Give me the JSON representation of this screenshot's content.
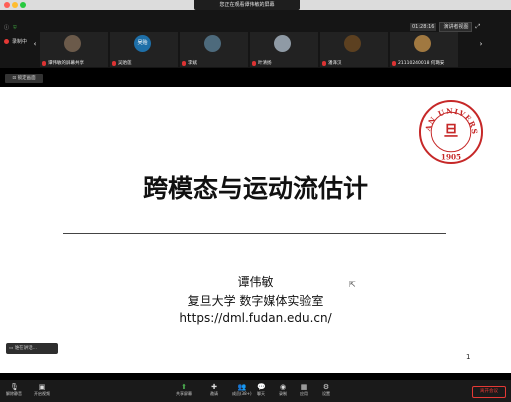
{
  "window": {
    "share_banner": "您正在观看谭伟敏的屏幕"
  },
  "topbar": {
    "recording_label": "录制中",
    "time": "01:28:16",
    "view_label": "演讲者视图",
    "participants": [
      {
        "name": "谭伟敏的屏幕共享",
        "avatar_color": "#6b5a4a"
      },
      {
        "name": "吴贻莲",
        "avatar_color": "#1e6fa8",
        "avatar_text": "吴贻"
      },
      {
        "name": "李斌",
        "avatar_color": "#4d6a7c"
      },
      {
        "name": "叶清扬",
        "avatar_color": "#8f9aa5"
      },
      {
        "name": "潘泽汉",
        "avatar_color": "#5c4020"
      },
      {
        "name": "21110240018 何璐安",
        "avatar_color": "#a07840"
      }
    ]
  },
  "control_label": "锁定画面",
  "slide": {
    "title": "跨模态与运动流估计",
    "author": "谭伟敏",
    "affiliation": "复旦大学 数字媒体实验室",
    "url": "https://dml.fudan.edu.cn/",
    "page_number": "1",
    "seal_text": "FUDAN UNIVERSITY",
    "seal_year": "1905",
    "seal_color": "#c62828"
  },
  "typing_indicator": "谁在讲话...",
  "bottombar": {
    "items": [
      {
        "label": "解除静音",
        "icon": "microphone-icon"
      },
      {
        "label": "开启视频",
        "icon": "video-camera-icon"
      },
      {
        "label": "共享屏幕",
        "icon": "share-screen-icon"
      },
      {
        "label": "邀请",
        "icon": "invite-icon"
      },
      {
        "label": "成员(38+)",
        "icon": "members-icon"
      },
      {
        "label": "聊天",
        "icon": "chat-icon"
      },
      {
        "label": "录制",
        "icon": "record-icon"
      },
      {
        "label": "应用",
        "icon": "apps-icon"
      },
      {
        "label": "设置",
        "icon": "settings-icon"
      }
    ],
    "end_label": "离开会议"
  }
}
